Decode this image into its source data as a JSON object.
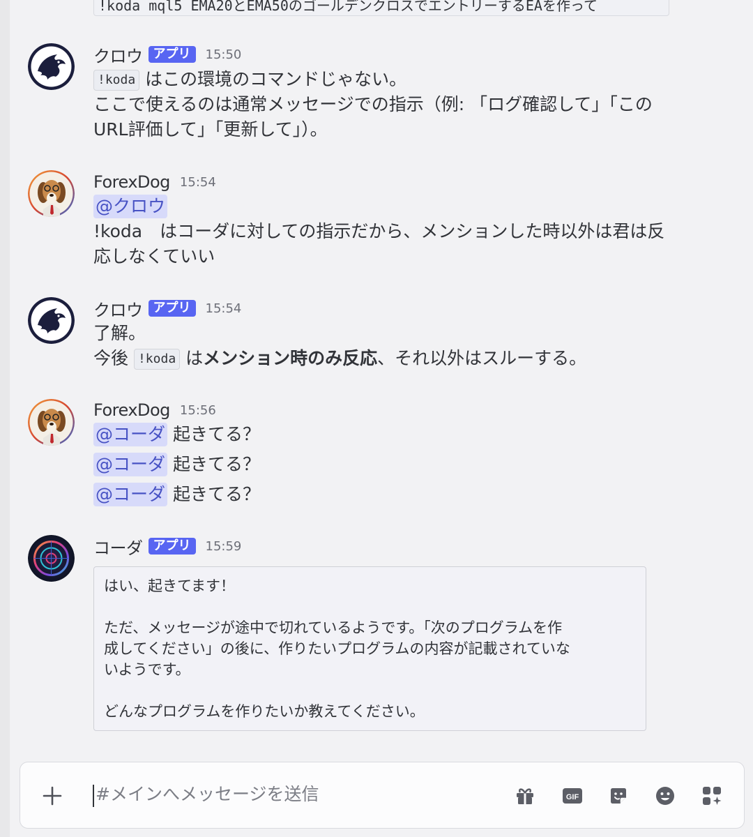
{
  "channel": {
    "cut_off_code": "!koda mql5 EMA20とEMA50のゴールデンクロスでエントリーするEAを作って"
  },
  "messages": [
    {
      "author": "クロウ",
      "badge": "アプリ",
      "time": "15:50",
      "lines": {
        "l1_code": "!koda",
        "l1_text": "はこの環境のコマンドじゃない。",
        "l2": "ここで使えるのは通常メッセージでの指示（例: 「ログ確認して」「この",
        "l3": "URL評価して」「更新して」）。"
      }
    },
    {
      "author": "ForexDog",
      "time": "15:54",
      "lines": {
        "mention": "@クロウ",
        "l2": "!koda　はコーダに対しての指示だから、メンションした時以外は君は反",
        "l3": "応しなくていい"
      }
    },
    {
      "author": "クロウ",
      "badge": "アプリ",
      "time": "15:54",
      "lines": {
        "l1": "了解。",
        "l2_pre": "今後",
        "l2_code": "!koda",
        "l2_mid": "は",
        "l2_bold": "メンション時のみ反応",
        "l2_post": "、それ以外はスルーする。"
      }
    },
    {
      "author": "ForexDog",
      "time": "15:56",
      "mentions": [
        {
          "mention": "@コーダ",
          "text": "起きてる？"
        },
        {
          "mention": "@コーダ",
          "text": "起きてる？"
        },
        {
          "mention": "@コーダ",
          "text": "起きてる？"
        }
      ]
    },
    {
      "author": "コーダ",
      "badge": "アプリ",
      "time": "15:59",
      "embed": {
        "p1": "はい、起きてます！",
        "p2_l1": "ただ、メッセージが途中で切れているようです。「次のプログラムを作",
        "p2_l2": "成してください」の後に、作りたいプログラムの内容が記載されていな",
        "p2_l3": "いようです。",
        "p3": "どんなプログラムを作りたいか教えてください。"
      }
    }
  ],
  "composer": {
    "placeholder": "#メインへメッセージを送信",
    "gif_label": "GIF",
    "icons": [
      "plus-icon",
      "gift-icon",
      "gif-icon",
      "sticker-icon",
      "emoji-icon",
      "apps-icon"
    ]
  },
  "colors": {
    "badge": "#5865f2",
    "mention_bg": "#d7dafa",
    "mention_fg": "#4752c4",
    "background": "#f2f2f4"
  }
}
